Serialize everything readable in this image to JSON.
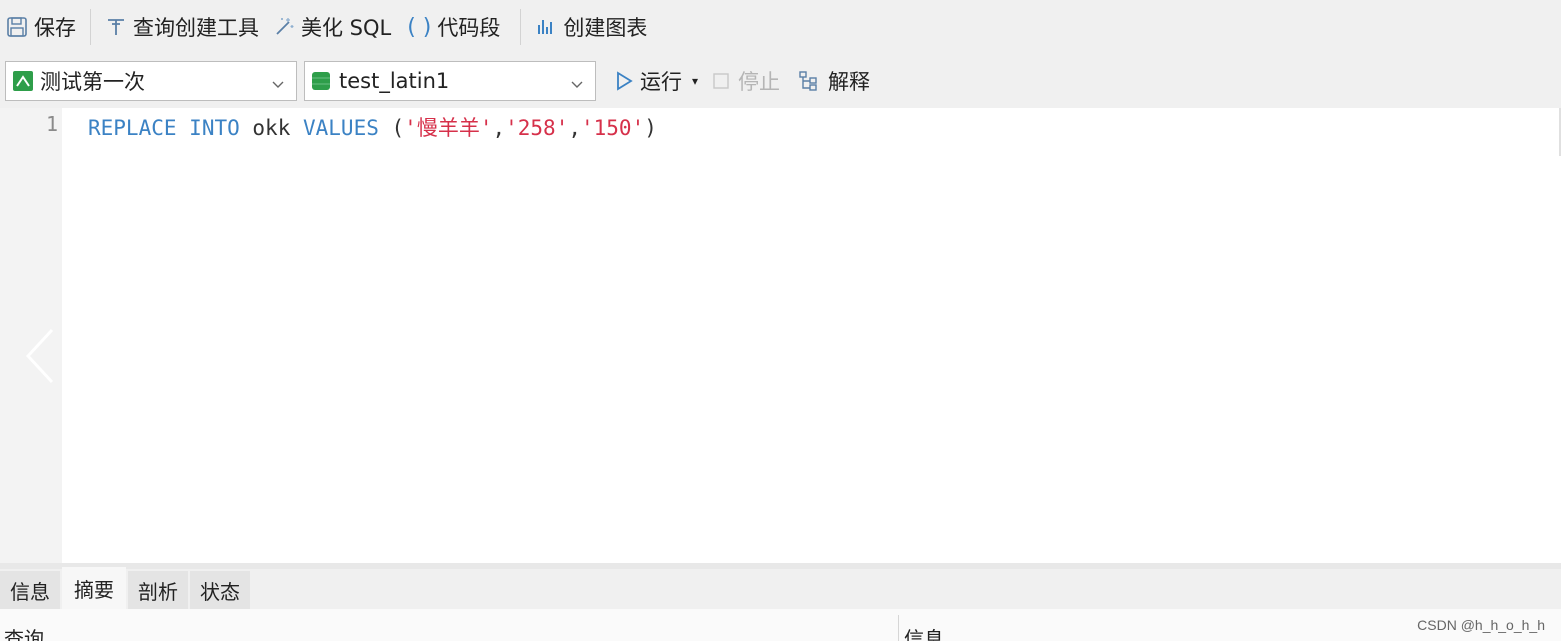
{
  "toolbar": {
    "save": "保存",
    "query_builder": "查询创建工具",
    "beautify_sql": "美化 SQL",
    "code_snippet": "代码段",
    "create_chart": "创建图表"
  },
  "connection_select": {
    "value": "测试第一次"
  },
  "database_select": {
    "value": "test_latin1"
  },
  "actions": {
    "run": "运行",
    "stop": "停止",
    "explain": "解释"
  },
  "editor": {
    "line_number": "1",
    "tokens": {
      "replace": "REPLACE",
      "into": "INTO",
      "table": "okk",
      "values": "VALUES",
      "open": "(",
      "str1": "'慢羊羊'",
      "comma1": ",",
      "str2": "'258'",
      "comma2": ",",
      "str3": "'150'",
      "close": ")"
    }
  },
  "result_tabs": [
    "信息",
    "摘要",
    "剖析",
    "状态"
  ],
  "result_columns": {
    "query": "查询",
    "info": "信息"
  },
  "watermark": "CSDN @h_h_o_h_h",
  "colors": {
    "keyword": "#3b82c4",
    "string": "#d6304a",
    "run_icon": "#3b82c4",
    "db_icon": "#2e9e4a"
  },
  "icons": [
    "save-icon",
    "query-builder-icon",
    "beautify-icon",
    "code-snippet-icon",
    "chart-icon",
    "connection-icon",
    "database-icon",
    "run-icon",
    "stop-icon",
    "explain-icon"
  ]
}
